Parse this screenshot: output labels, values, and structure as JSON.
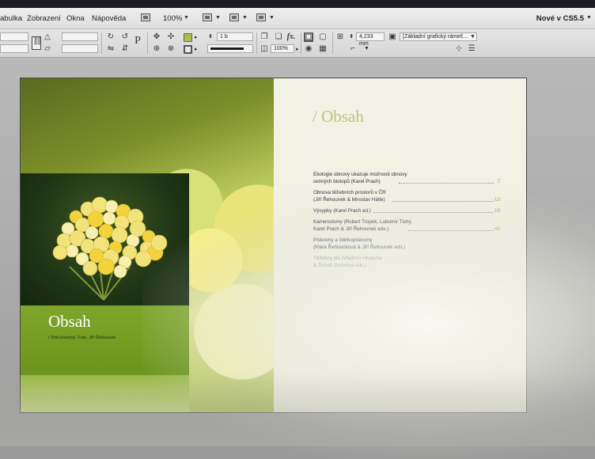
{
  "menubar": {
    "items": [
      "abulka",
      "Zobrazení",
      "Okna",
      "Nápověda"
    ],
    "zoom": "100%",
    "workspace": "Nové v CS5.5"
  },
  "controlbar": {
    "stroke_weight": "1 b",
    "opacity": "100%",
    "size_value": "4,233 mm",
    "object_style": "[Základní grafický rámeč..."
  },
  "colors": {
    "fill_swatch": "#a9bf4a",
    "stroke_swatch": "#1a1a1a",
    "accent_green": "#7ea62a"
  },
  "left_page": {
    "title": "Obsah",
    "caption": "/ Smil písečný. Foto: Jiří Řehounek"
  },
  "right_page": {
    "heading": "/ Obsah",
    "toc": [
      {
        "lines": [
          "Ekologie obnovy ukazuje možnosti obnovy",
          "cenných biotopů (Karel Prach)"
        ],
        "page": "7"
      },
      {
        "lines": [
          "Obnova těžebních prostorů v ČR",
          "(Jiří Řehounek & Miroslav Hátle)"
        ],
        "page": "13"
      },
      {
        "lines": [
          "Výsypky (Karel Prach ed.)"
        ],
        "page": "19"
      },
      {
        "lines": [
          "Kamenolomy (Robert Tropek, Lubomír Tichý,",
          "Karel Prach & Jiří Řehounek eds.)"
        ],
        "page": "45"
      },
      {
        "lines": [
          "Pískovny a štěrkopískovny",
          "(Klára Řehounková & Jiří Řehounek eds.)"
        ],
        "page": ""
      },
      {
        "lines": [
          "Těžebny jílů (Vladimír Hrubcha",
          "& Tomáš Gremlica eds.)"
        ],
        "page": ""
      }
    ]
  }
}
